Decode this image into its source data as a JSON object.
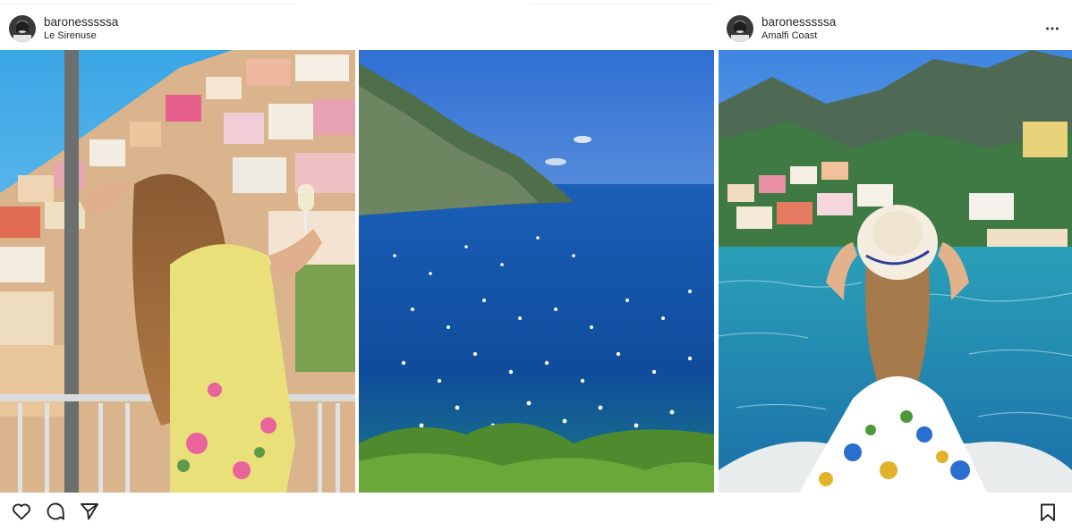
{
  "posts": [
    {
      "username": "baronesssssa",
      "location": "Le Sirenuse",
      "image_alt": "woman-on-balcony-positano"
    },
    {
      "image_alt": "positano-bay-boats"
    },
    {
      "username": "baronesssssa",
      "location": "Amalfi Coast",
      "image_alt": "woman-on-boat-positano-hat"
    }
  ],
  "icons": {
    "like": "heart-icon",
    "comment": "comment-icon",
    "share": "paper-plane-icon",
    "save": "bookmark-icon",
    "more": "more-horizontal-icon"
  },
  "colors": {
    "text": "#262626",
    "background": "#ffffff",
    "divider": "#efefef"
  }
}
